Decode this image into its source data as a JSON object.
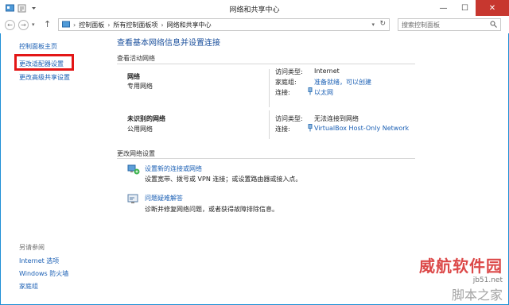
{
  "window": {
    "title": "网络和共享中心",
    "min": "—",
    "max": "☐",
    "close": "✕"
  },
  "nav": {
    "breadcrumb": [
      "控制面板",
      "所有控制面板项",
      "网络和共享中心"
    ],
    "search_placeholder": "搜索控制面板"
  },
  "sidebar": {
    "items": [
      "控制面板主页",
      "更改适配器设置",
      "更改高级共享设置"
    ],
    "see_also_title": "另请参阅",
    "see_also": [
      "Internet 选项",
      "Windows 防火墙",
      "家庭组"
    ]
  },
  "main": {
    "title": "查看基本网络信息并设置连接",
    "active_networks_title": "查看活动网络",
    "networks": [
      {
        "name": "网络",
        "profile": "专用网络",
        "access_type_label": "访问类型:",
        "access_type": "Internet",
        "homegroup_label": "家庭组:",
        "homegroup": "准备就绪，可以创建",
        "connection_label": "连接:",
        "connection": "以太网"
      },
      {
        "name": "未识别的网络",
        "profile": "公用网络",
        "access_type_label": "访问类型:",
        "access_type": "无法连接到网络",
        "connection_label": "连接:",
        "connection": "VirtualBox Host-Only Network"
      }
    ],
    "change_settings_title": "更改网络设置",
    "settings": [
      {
        "link": "设置新的连接或网络",
        "desc": "设置宽带、拨号或 VPN 连接；或设置路由器或接入点。"
      },
      {
        "link": "问题疑难解答",
        "desc": "诊断并修复网络问题，或者获得故障排除信息。"
      }
    ]
  },
  "watermark": {
    "brand": "威航软件园",
    "site": "jb51.net",
    "slogan": "脚本之家"
  },
  "colors": {
    "link": "#1a5fb4",
    "title": "#1a4f9c",
    "highlight_box": "#e31616",
    "close_button": "#c7372f"
  }
}
